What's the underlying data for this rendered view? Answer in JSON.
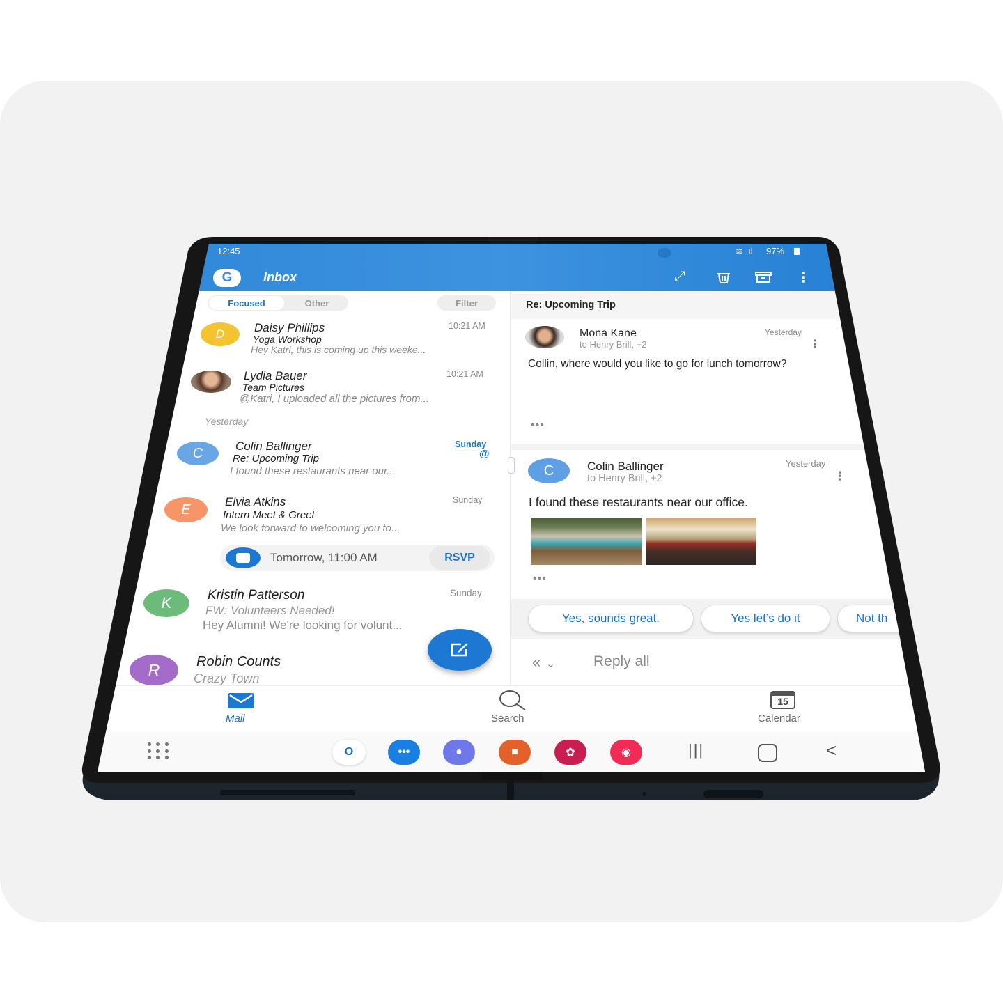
{
  "status_bar": {
    "time": "12:45",
    "battery": "97%",
    "signal": "wifi-signal-icons"
  },
  "app_bar": {
    "account_icon": "google-logo-icon",
    "title": "Inbox",
    "actions": [
      {
        "name": "expand",
        "icon": "expand-icon"
      },
      {
        "name": "delete",
        "icon": "trash-icon"
      },
      {
        "name": "archive",
        "icon": "archive-icon"
      },
      {
        "name": "more",
        "icon": "more-vertical-icon"
      }
    ]
  },
  "inbox": {
    "tabs": [
      {
        "label": "Focused",
        "active": true
      },
      {
        "label": "Other",
        "active": false
      }
    ],
    "filter_label": "Filter",
    "section_yesterday": "Yesterday",
    "messages": [
      {
        "initial": "D",
        "color": "#f4c430",
        "sender": "Daisy Phillips",
        "subject": "Yoga Workshop",
        "preview": "Hey Katri, this is coming up this weeke...",
        "time": "10:21 AM"
      },
      {
        "initial": "",
        "photo": true,
        "sender": "Lydia Bauer",
        "subject": "Team Pictures",
        "preview": "@Katri, I uploaded all the pictures from...",
        "time": "10:21 AM"
      },
      {
        "initial": "C",
        "color": "#6aa6e4",
        "sender": "Colin Ballinger",
        "subject": "Re: Upcoming Trip",
        "preview": "I found these restaurants near our...",
        "time": "Sunday",
        "mention": "@"
      },
      {
        "initial": "E",
        "color": "#f59568",
        "sender": "Elvia Atkins",
        "subject": "Intern Meet & Greet",
        "preview": "We look forward to welcoming you to...",
        "time": "Sunday",
        "event": {
          "text": "Tomorrow, 11:00 AM",
          "action": "RSVP"
        }
      },
      {
        "initial": "K",
        "color": "#6cbb7a",
        "sender": "Kristin Patterson",
        "subject": "FW: Volunteers Needed!",
        "preview": "Hey Alumni! We're looking for volunt...",
        "time": "Sunday"
      },
      {
        "initial": "R",
        "color": "#a46bc8",
        "sender": "Robin Counts",
        "subject": "Crazy Town",
        "preview": "",
        "time": ""
      }
    ]
  },
  "reader": {
    "subject": "Re: Upcoming Trip",
    "messages": [
      {
        "sender": "Mona Kane",
        "to": "to Henry Brill, +2",
        "time": "Yesterday",
        "body": "Collin, where would  you like to go for lunch tomorrow?",
        "photo": true
      },
      {
        "initial": "C",
        "sender": "Colin Ballinger",
        "to": "to Henry Brill, +2",
        "time": "Yesterday",
        "body": "I found these restaurants near our office.",
        "attachments": [
          "restaurant-photo-1",
          "restaurant-photo-2"
        ]
      }
    ],
    "quick_replies": [
      "Yes, sounds great.",
      "Yes let’s do it",
      "Not th"
    ],
    "reply_label": "Reply all"
  },
  "tab_bar": [
    {
      "label": "Mail",
      "icon": "mail-icon",
      "active": true
    },
    {
      "label": "Search",
      "icon": "search-icon",
      "active": false
    },
    {
      "label": "Calendar",
      "icon": "calendar-icon",
      "active": false,
      "badge": "15"
    }
  ],
  "dock": {
    "apps": [
      {
        "name": "outlook",
        "label": "O",
        "color": "#ffffff",
        "fg": "#1b6ec2"
      },
      {
        "name": "messages",
        "label": "•••",
        "color": "#1a7fe0",
        "fg": "#ffffff"
      },
      {
        "name": "internet",
        "label": "●",
        "color": "#6f78e8",
        "fg": "#ffffff"
      },
      {
        "name": "notes",
        "label": "■",
        "color": "#e3622b",
        "fg": "#ffffff"
      },
      {
        "name": "gallery",
        "label": "✿",
        "color": "#c91e52",
        "fg": "#ffffff"
      },
      {
        "name": "camera",
        "label": "◉",
        "color": "#ef2b56",
        "fg": "#ffffff"
      }
    ],
    "nav": {
      "recents": "|||",
      "home": "▢",
      "back": "<"
    }
  },
  "colors": {
    "accent": "#1b73c9",
    "appbar": "#2a83d6"
  }
}
